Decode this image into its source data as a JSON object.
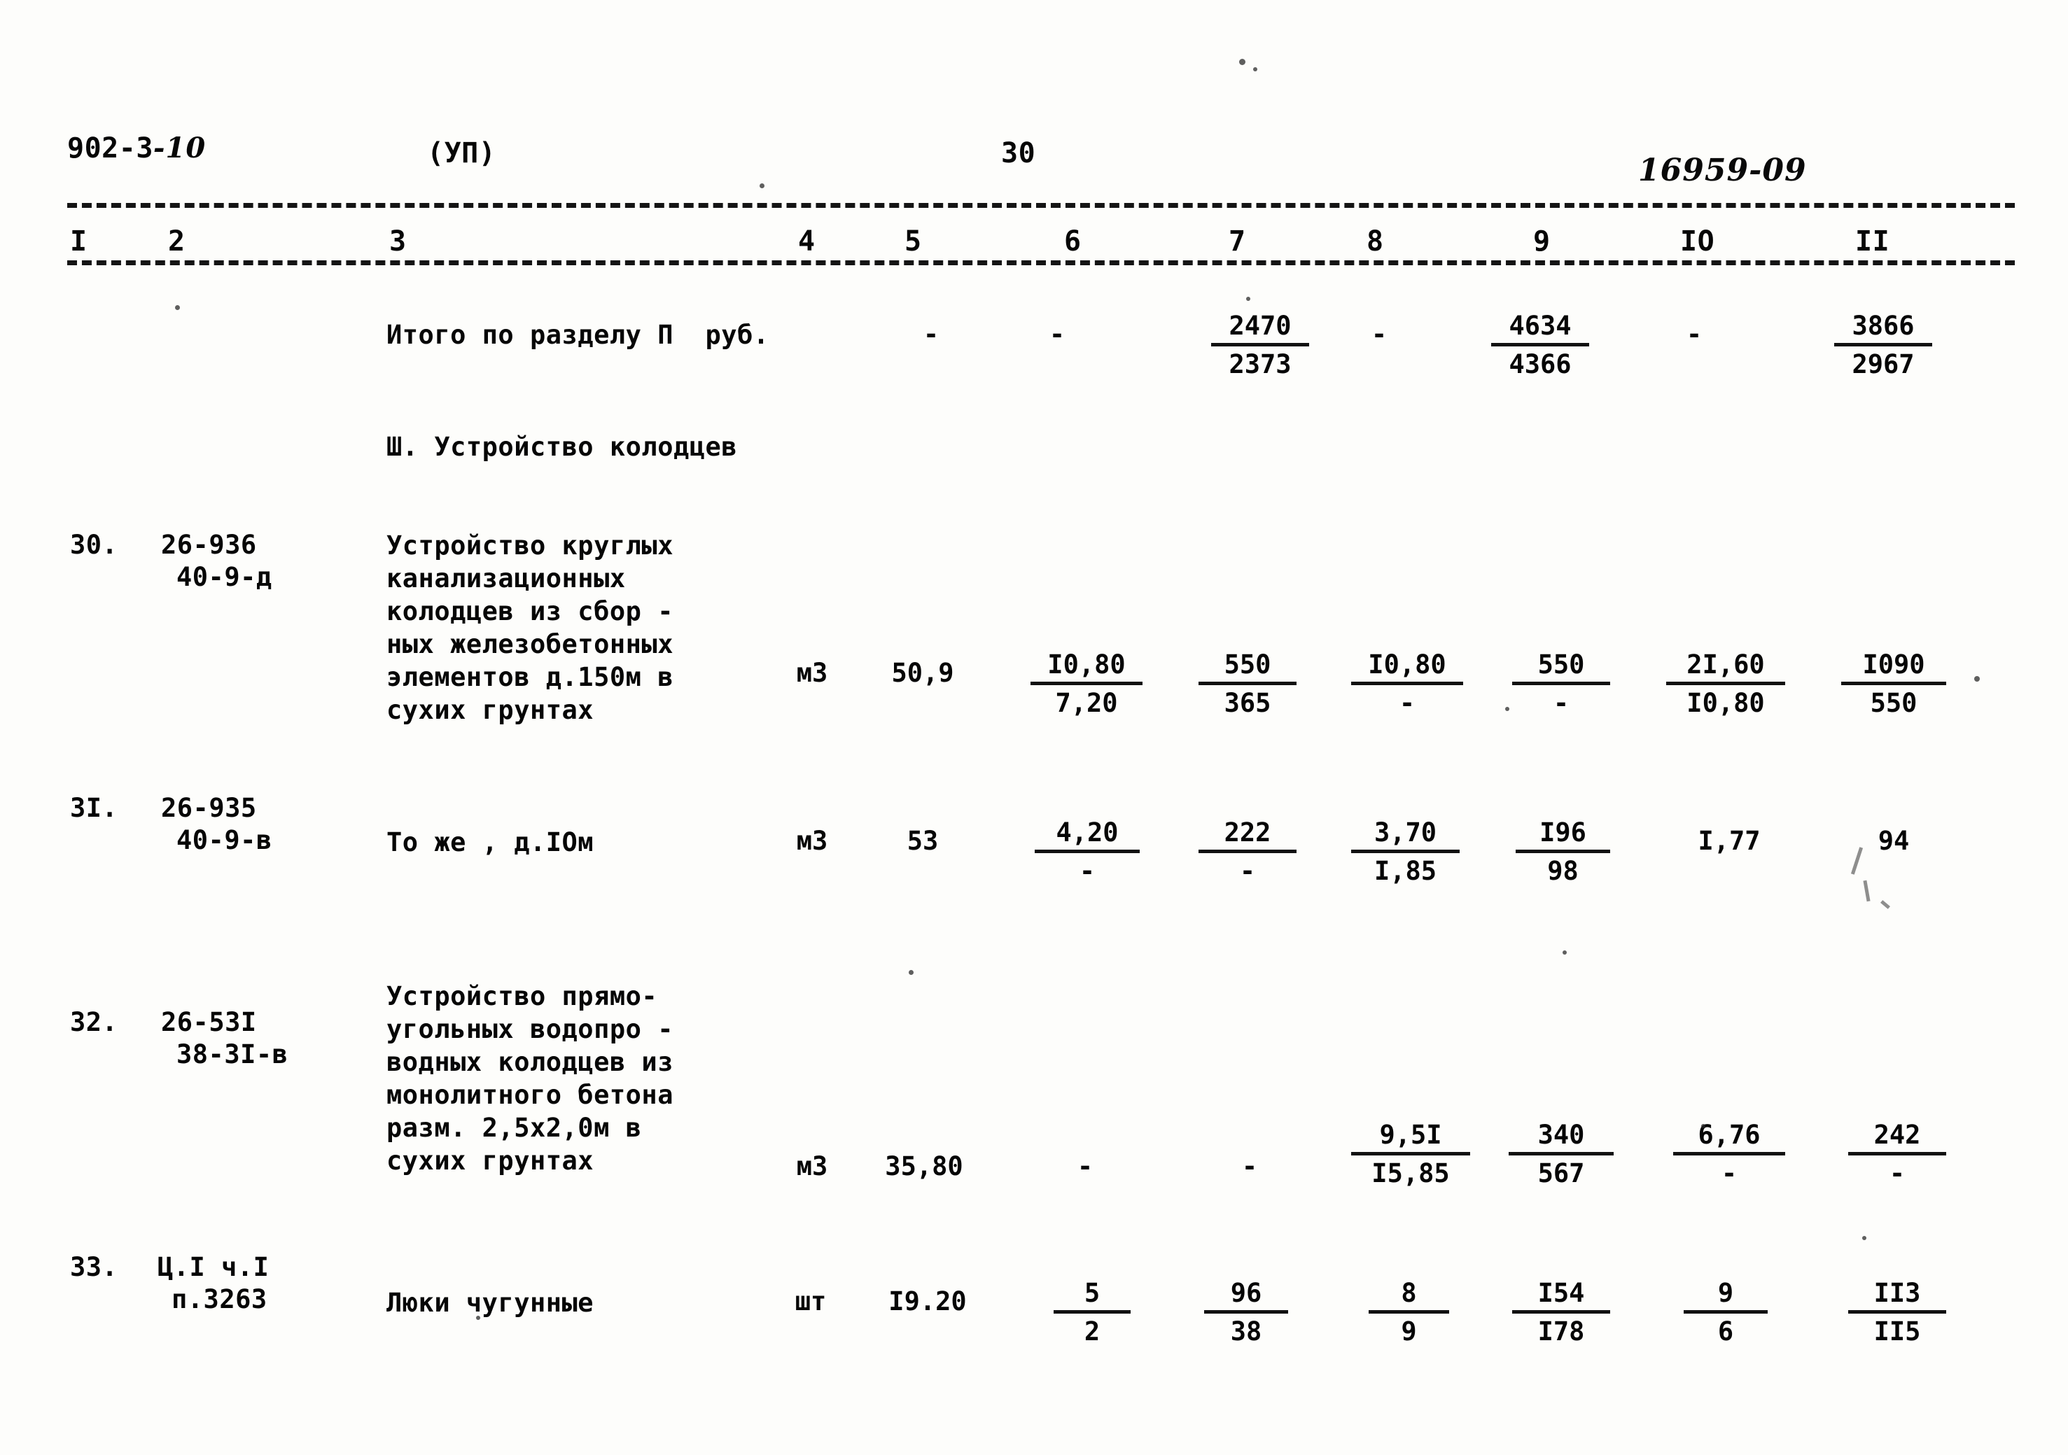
{
  "header": {
    "doc_code_main": "902-3",
    "doc_code_suffix": "-10",
    "series": "(УП)",
    "page_number": "30",
    "archive_number": "16959-09"
  },
  "column_numbers": [
    "I",
    "2",
    "3",
    "4",
    "5",
    "6",
    "7",
    "8",
    "9",
    "IO",
    "II"
  ],
  "section_heading": "Ш. Устройство колодцев",
  "total_row": {
    "label": "Итого по разделу П  руб.",
    "col4": "-",
    "col5": "-",
    "col6": "-",
    "col7_top": "2470",
    "col7_bot": "2373",
    "col8": "-",
    "col9_top": "4634",
    "col9_bot": "4366",
    "col10": "-",
    "col11_top": "3866",
    "col11_bot": "2967"
  },
  "rows": [
    {
      "no": "30.",
      "code_line1": "26-936",
      "code_line2": "40-9-д",
      "description": [
        "Устройство круглых",
        "канализационных",
        "колодцев из сбор -",
        "ных железобетонных",
        "элементов д.150м в",
        "сухих грунтах"
      ],
      "unit": "м3",
      "qty": "50,9",
      "c6_top": "I0,80",
      "c6_bot": "7,20",
      "c7_top": "550",
      "c7_bot": "365",
      "c8_top": "I0,80",
      "c8_bot": "-",
      "c9_top": "550",
      "c9_bot": "-",
      "c10_top": "2I,60",
      "c10_bot": "I0,80",
      "c11_top": "I090",
      "c11_bot": "550"
    },
    {
      "no": "3I.",
      "code_line1": "26-935",
      "code_line2": "40-9-в",
      "description": [
        "То же , д.IОм"
      ],
      "unit": "м3",
      "qty": "53",
      "c6_top": "4,20",
      "c6_bot": "-",
      "c7_top": "222",
      "c7_bot": "-",
      "c8_top": "3,70",
      "c8_bot": "I,85",
      "c9_top": "I96",
      "c9_bot": "98",
      "c10_top": "I,77",
      "c10_bot": "",
      "c11_top": "94",
      "c11_bot": ""
    },
    {
      "no": "32.",
      "code_line1": "26-53I",
      "code_line2": "38-3I-в",
      "description": [
        "Устройство прямо-",
        "угольных водопро -",
        "водных колодцев из",
        "монолитного бетона",
        "разм. 2,5х2,0м в",
        "сухих грунтах"
      ],
      "unit": "м3",
      "qty": "35,80",
      "c6_top": "-",
      "c6_bot": "",
      "c7_top": "-",
      "c7_bot": "",
      "c8_top": "9,5I",
      "c8_bot": "I5,85",
      "c9_top": "340",
      "c9_bot": "567",
      "c10_top": "6,76",
      "c10_bot": "-",
      "c11_top": "242",
      "c11_bot": "-"
    },
    {
      "no": "33.",
      "code_line1": "Ц.I ч.I",
      "code_line2": "п.3263",
      "description": [
        "Люки чугунные"
      ],
      "unit": "шт",
      "qty": "I9.20",
      "c6_top": "5",
      "c6_bot": "2",
      "c7_top": "96",
      "c7_bot": "38",
      "c8_top": "8",
      "c8_bot": "9",
      "c9_top": "I54",
      "c9_bot": "I78",
      "c10_top": "9",
      "c10_bot": "6",
      "c11_top": "II3",
      "c11_bot": "II5"
    }
  ]
}
